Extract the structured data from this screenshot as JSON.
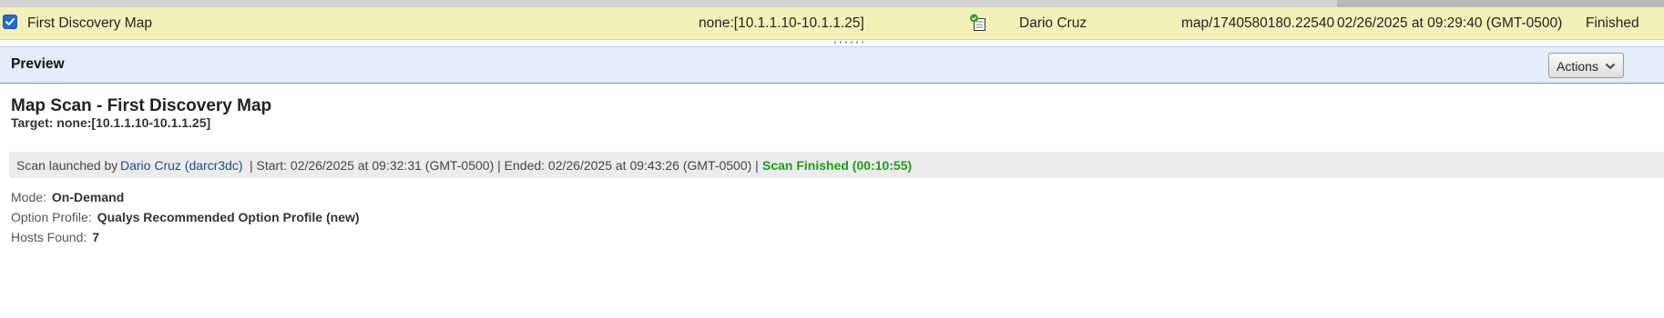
{
  "row": {
    "checked": true,
    "title": "First Discovery Map",
    "target": "none:[10.1.1.10-10.1.1.25]",
    "user": "Dario Cruz",
    "reference": "map/1740580180.22540",
    "launch_date": "02/26/2025 at 09:29:40 (GMT-0500)",
    "status": "Finished"
  },
  "preview": {
    "heading": "Preview",
    "actions_label": "Actions"
  },
  "scan": {
    "title": "Map Scan - First Discovery Map",
    "target": "Target: none:[10.1.1.10-10.1.1.25]",
    "launched_prefix": "Scan launched by",
    "launched_by": "Dario Cruz (darcr3dc)",
    "times": "| Start: 02/26/2025 at 09:32:31 (GMT-0500) | Ended: 02/26/2025 at 09:43:26 (GMT-0500) |",
    "finished": "Scan Finished (00:10:55)"
  },
  "details": {
    "mode_label": "Mode:",
    "mode_value": "On-Demand",
    "option_label": "Option Profile:",
    "option_value": "Qualys Recommended Option Profile (new)",
    "hosts_label": "Hosts Found:",
    "hosts_value": "7"
  },
  "colors": {
    "row_highlight": "#f4f1b8",
    "preview_bar": "#e3eefa",
    "link": "#1a4b8c",
    "finished": "#18a018"
  }
}
